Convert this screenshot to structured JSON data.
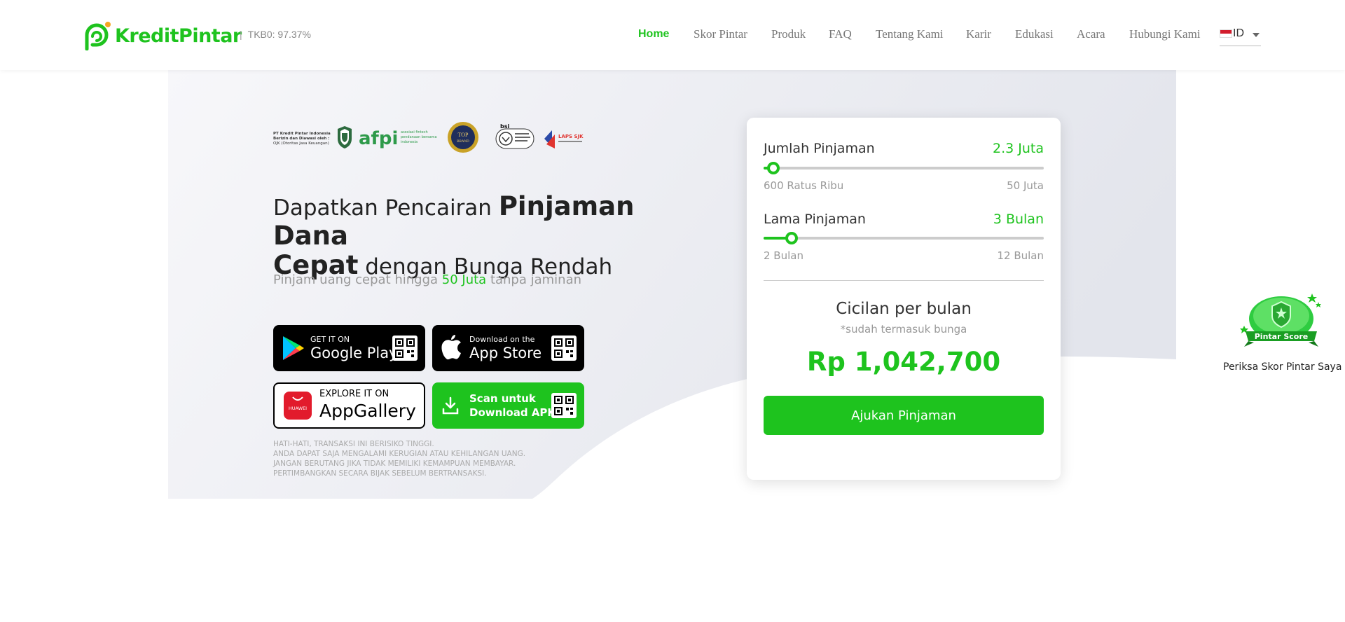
{
  "header": {
    "brand": "KreditPintar",
    "tkb_sep": "|",
    "tkb": "TKB0: 97.37%",
    "nav": [
      {
        "label": "Home",
        "active": true
      },
      {
        "label": "Skor Pintar"
      },
      {
        "label": "Produk"
      },
      {
        "label": "FAQ"
      },
      {
        "label": "Tentang Kami"
      },
      {
        "label": "Karir"
      },
      {
        "label": "Edukasi"
      },
      {
        "label": "Acara"
      },
      {
        "label": "Hubungi Kami"
      }
    ],
    "language": "ID"
  },
  "hero": {
    "partners": {
      "ojk_lines": [
        "PT Kredit Pintar Indonesia",
        "Berizin dan Diawasi oleh :",
        "OJK (Otoritas Jasa Keuangan)"
      ],
      "afpi": "afpi",
      "afpi_caption": [
        "asosiasi fintech",
        "pendanaan bersama",
        "indonesia"
      ],
      "top_brand": [
        "TOP",
        "BRAND"
      ],
      "bsi": "bsi",
      "laps": "LAPS SJK"
    },
    "title_part1": "Dapatkan Pencairan ",
    "title_bold1": "Pinjaman Dana",
    "title_bold2": "Cepat",
    "title_part2": " dengan Bunga Rendah",
    "subtitle_pre": "Pinjam uang cepat hingga ",
    "subtitle_highlight": "50 Juta",
    "subtitle_post": " tanpa jaminan",
    "stores": {
      "google_small": "GET IT ON",
      "google_big": "Google Play",
      "apple_small": "Download on the",
      "apple_big": "App Store",
      "huawei_logo": "HUAWEI",
      "huawei_small": "EXPLORE IT ON",
      "huawei_big": "AppGallery",
      "apk_line1": "Scan untuk",
      "apk_line2": "Download APK"
    },
    "warning": [
      "HATI-HATI, TRANSAKSI INI BERISIKO TINGGI.",
      "ANDA DAPAT SAJA MENGALAMI KERUGIAN ATAU KEHILANGAN UANG.",
      "JANGAN BERUTANG JIKA TIDAK MEMILIKI KEMAMPUAN MEMBAYAR.",
      "PERTIMBANGKAN SECARA BIJAK SEBELUM BERTRANSAKSI."
    ]
  },
  "calculator": {
    "amount": {
      "label": "Jumlah Pinjaman",
      "value": "2.3 Juta",
      "min": "600 Ratus Ribu",
      "max": "50 Juta",
      "fraction": 0.035
    },
    "tenor": {
      "label": "Lama Pinjaman",
      "value": "3 Bulan",
      "min": "2 Bulan",
      "max": "12 Bulan",
      "fraction": 0.1
    },
    "installment_title": "Cicilan per bulan",
    "installment_note": "*sudah termasuk bunga",
    "installment_amount": "Rp 1,042,700",
    "apply_label": "Ajukan Pinjaman"
  },
  "score_widget": {
    "badge_text": "Pintar Score",
    "caption": "Periksa Skor Pintar Saya"
  },
  "colors": {
    "accent": "#1ec31e",
    "text": "#222222",
    "muted": "#999999"
  }
}
